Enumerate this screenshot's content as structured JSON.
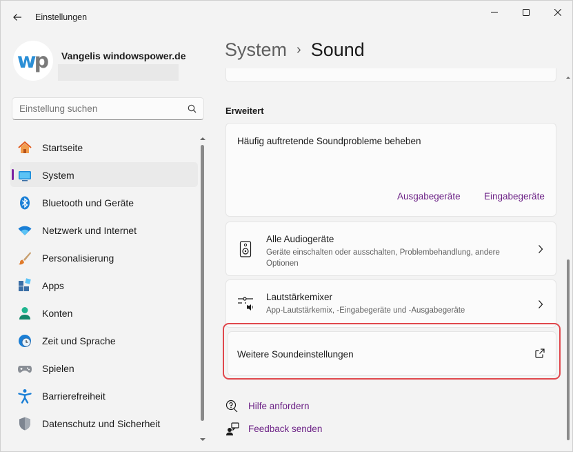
{
  "window": {
    "title": "Einstellungen"
  },
  "profile": {
    "name": "Vangelis windowspower.de",
    "avatar_left": "w",
    "avatar_right": "p"
  },
  "search": {
    "placeholder": "Einstellung suchen"
  },
  "nav": {
    "items": [
      {
        "label": "Startseite",
        "icon": "home-icon"
      },
      {
        "label": "System",
        "icon": "system-icon",
        "selected": true
      },
      {
        "label": "Bluetooth und Geräte",
        "icon": "bluetooth-icon"
      },
      {
        "label": "Netzwerk und Internet",
        "icon": "wifi-icon"
      },
      {
        "label": "Personalisierung",
        "icon": "brush-icon"
      },
      {
        "label": "Apps",
        "icon": "apps-icon"
      },
      {
        "label": "Konten",
        "icon": "account-icon"
      },
      {
        "label": "Zeit und Sprache",
        "icon": "clock-globe-icon"
      },
      {
        "label": "Spielen",
        "icon": "gamepad-icon"
      },
      {
        "label": "Barrierefreiheit",
        "icon": "accessibility-icon"
      },
      {
        "label": "Datenschutz und Sicherheit",
        "icon": "shield-icon"
      }
    ]
  },
  "breadcrumb": {
    "parent": "System",
    "separator": "›",
    "current": "Sound"
  },
  "advanced": {
    "section_title": "Erweitert",
    "troubleshoot": {
      "title": "Häufig auftretende Soundprobleme beheben",
      "link_output": "Ausgabegeräte",
      "link_input": "Eingabegeräte"
    },
    "all_devices": {
      "title": "Alle Audiogeräte",
      "description": "Geräte einschalten oder ausschalten, Problembehandlung, andere Optionen"
    },
    "mixer": {
      "title": "Lautstärkemixer",
      "description": "App-Lautstärkemix, -Eingabegeräte und -Ausgabegeräte"
    },
    "more_settings": {
      "title": "Weitere Soundeinstellungen"
    }
  },
  "help": {
    "get_help": "Hilfe anfordern",
    "feedback": "Feedback senden"
  },
  "colors": {
    "accent": "#6b2085",
    "highlight": "#e0474c",
    "background": "#f3f3f3",
    "card": "#fbfbfb"
  }
}
